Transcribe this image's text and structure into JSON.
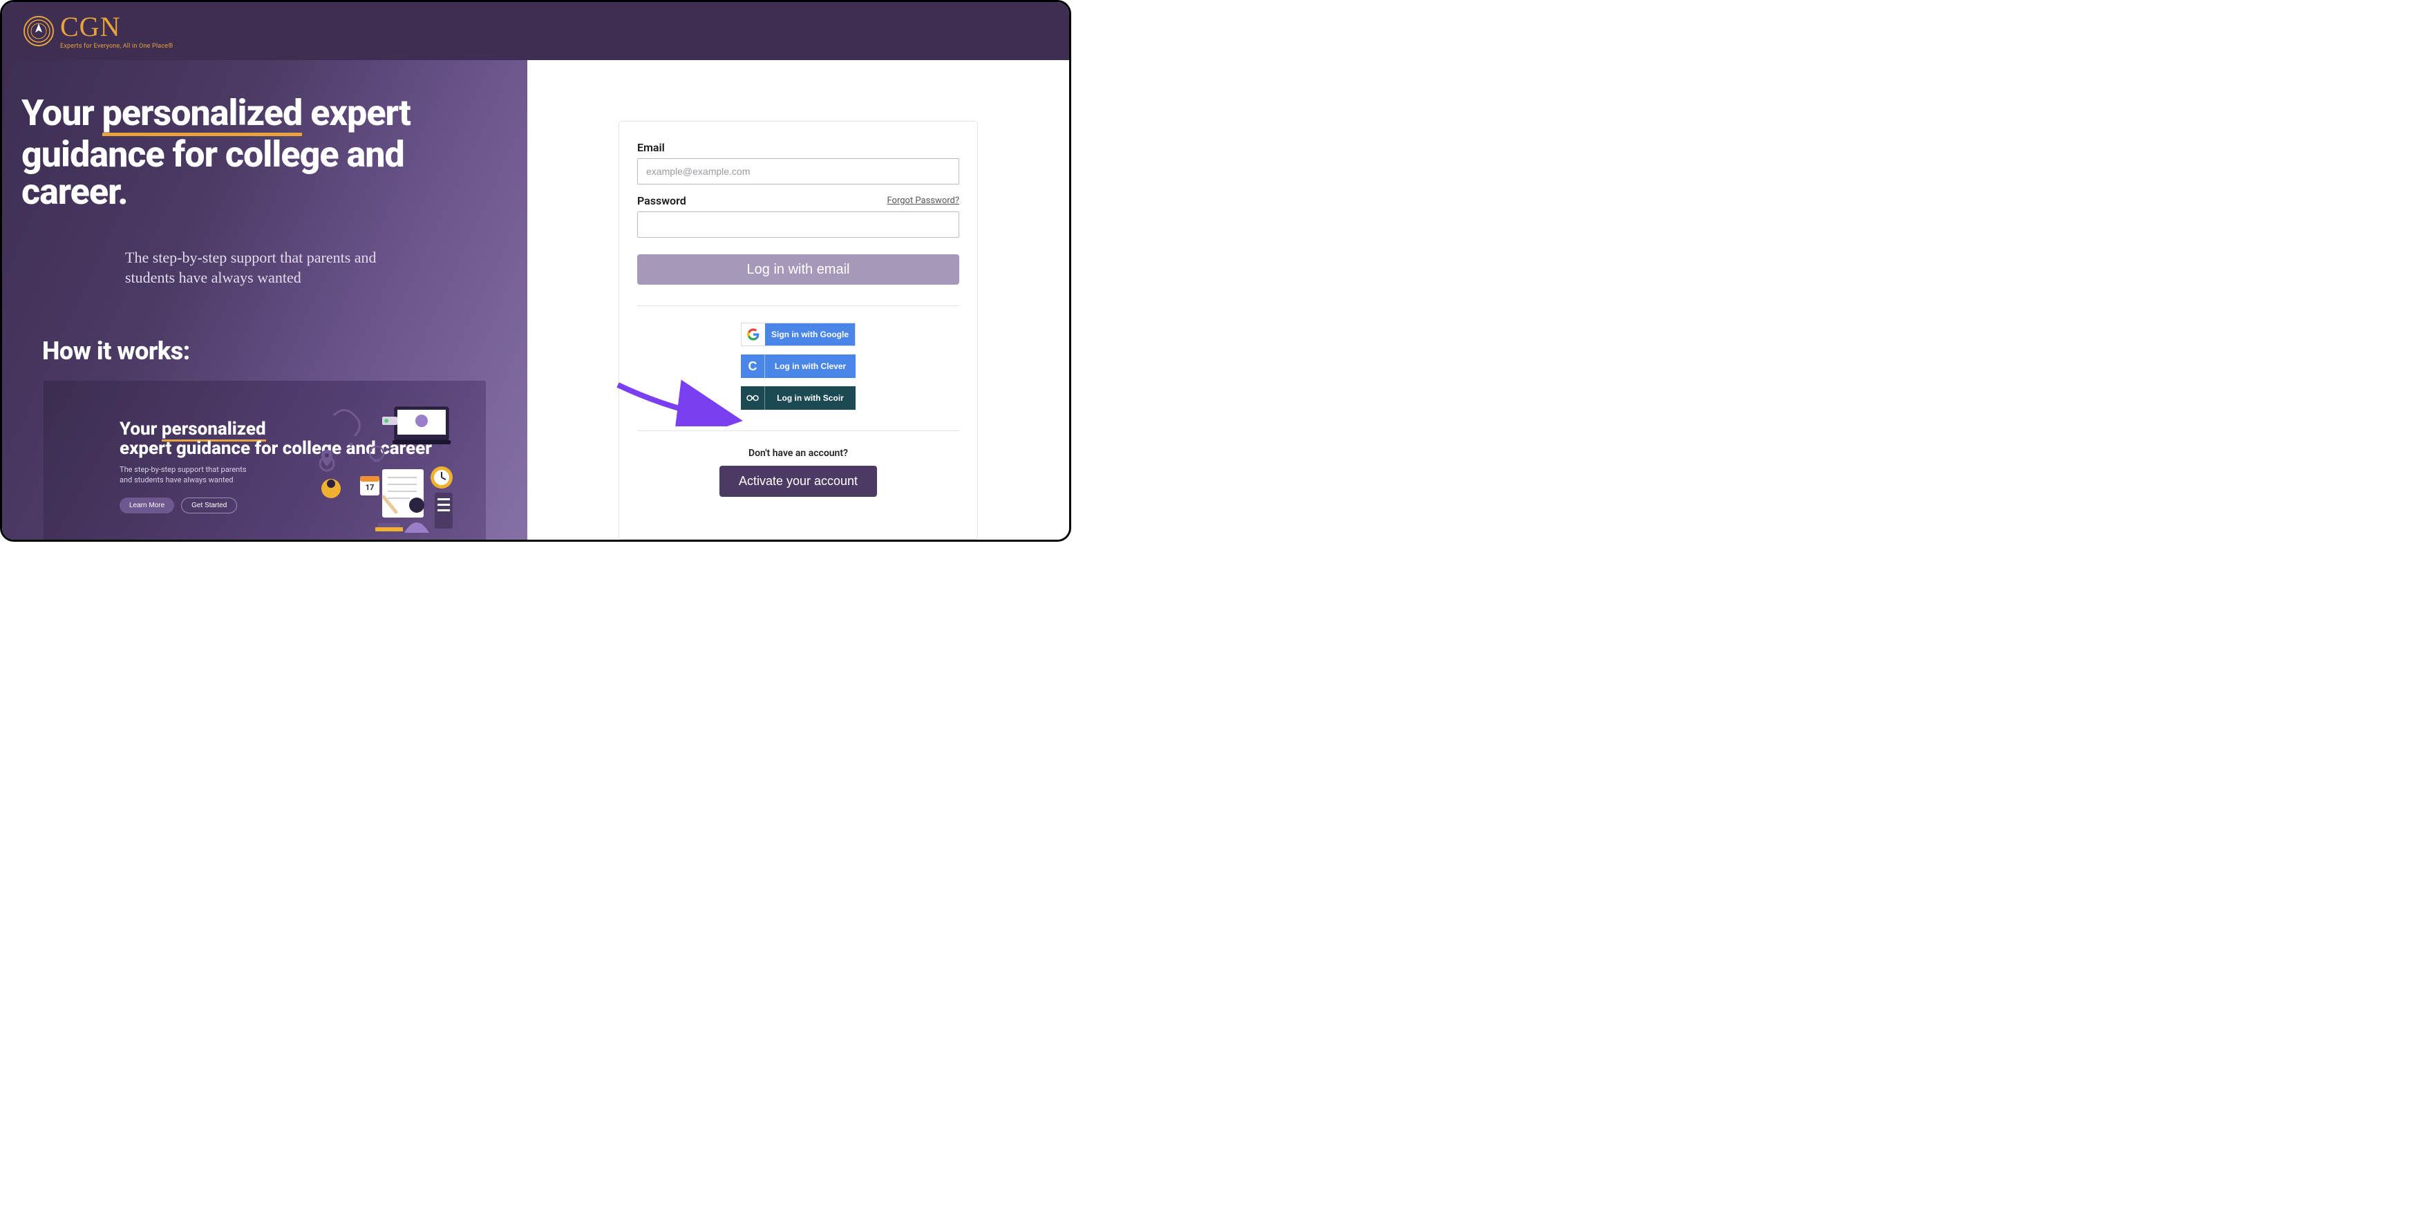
{
  "brand": {
    "name": "CGN",
    "tagline": "Experts for Everyone, All in One Place®"
  },
  "hero": {
    "title_pre": "Your ",
    "title_emph": "personalized",
    "title_post": " expert guidance for college and career.",
    "subtitle": "The step-by-step support that parents and students have always wanted",
    "how_heading": "How it works:"
  },
  "preview": {
    "title_pre": "Your ",
    "title_emph": "personalized",
    "title_rest": " expert guidance for college and career",
    "subtitle": "The step-by-step support that parents and students have always wanted",
    "learn_more": "Learn More",
    "get_started": "Get Started"
  },
  "login": {
    "email_label": "Email",
    "email_placeholder": "example@example.com",
    "password_label": "Password",
    "forgot_password": "Forgot Password?",
    "login_button": "Log in with email",
    "google": "Sign in with Google",
    "clever": "Log in with Clever",
    "clever_icon_letter": "C",
    "scoir": "Log in with Scoir",
    "no_account": "Don't have an account?",
    "activate": "Activate your account"
  }
}
